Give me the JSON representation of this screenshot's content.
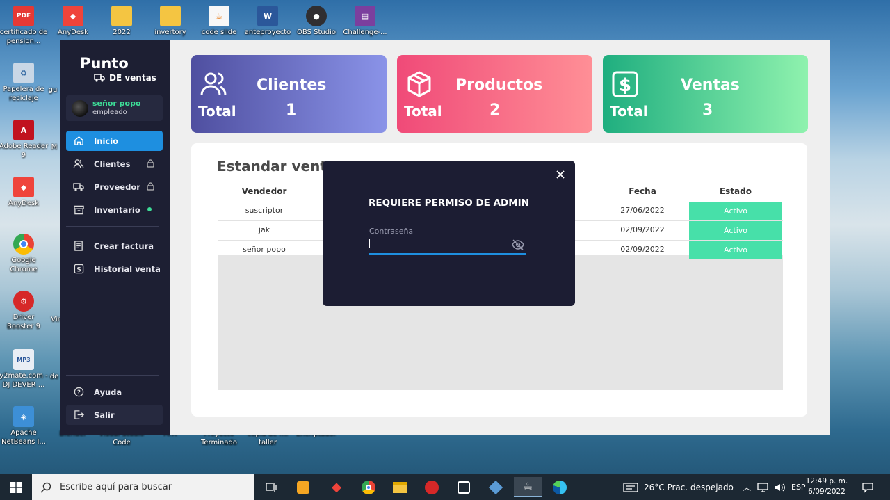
{
  "desktop": {
    "icons": [
      {
        "label": "certificado de pension...",
        "icon": "pdf-icon",
        "color": "#e53935"
      },
      {
        "label": "AnyDesk",
        "icon": "anydesk-icon",
        "color": "#ef443b"
      },
      {
        "label": "2022",
        "icon": "folder-icon",
        "color": "#f4c542"
      },
      {
        "label": "invertory",
        "icon": "folder-icon",
        "color": "#f4c542"
      },
      {
        "label": "code slide",
        "icon": "java-icon",
        "color": "#f7f7f7"
      },
      {
        "label": "anteproyecto",
        "icon": "word-icon",
        "color": "#2b579a"
      },
      {
        "label": "OBS Studio",
        "icon": "obs-icon",
        "color": "#302e31"
      },
      {
        "label": "Challenge-...",
        "icon": "winrar-icon",
        "color": "#7b3f9e"
      },
      {
        "label": "Papelera de reciclaje",
        "icon": "recycle-bin-icon",
        "color": "#c9d7e6"
      },
      {
        "label": "Adobe Reader 9",
        "icon": "adobe-reader-icon",
        "color": "#c1121f"
      },
      {
        "label": "AnyDesk",
        "icon": "anydesk-icon",
        "color": "#ef443b"
      },
      {
        "label": "Google Chrome",
        "icon": "chrome-icon",
        "color": "#4285f4"
      },
      {
        "label": "Driver Booster 9",
        "icon": "driver-booster-icon",
        "color": "#d62828"
      },
      {
        "label": "y2mate.com - DJ DEVER ...",
        "icon": "mp3-icon",
        "color": "#e9eef5"
      },
      {
        "label": "Apache NetBeans I...",
        "icon": "netbeans-icon",
        "color": "#3d8fd6"
      }
    ],
    "partial_labels": [
      "gu",
      "M",
      "Vir",
      "de",
      "Blender",
      "Visual Studio Code",
      "AFA",
      "Proyecto Terminado",
      "copia de mi taller",
      "Encriptador"
    ]
  },
  "app": {
    "brand_title": "Punto",
    "brand_subtitle": "DE ventas",
    "user": {
      "name": "señor popo",
      "role": "empleado"
    },
    "nav": [
      {
        "label": "Inicio",
        "icon": "home-icon",
        "active": true
      },
      {
        "label": "Clientes",
        "icon": "users-icon",
        "lock": true
      },
      {
        "label": "Proveedor",
        "icon": "truck-icon",
        "lock": true
      },
      {
        "label": "Inventario",
        "icon": "archive-icon",
        "dot": true
      },
      {
        "label": "Crear factura",
        "icon": "invoice-icon"
      },
      {
        "label": "Historial venta",
        "icon": "dollar-icon"
      }
    ],
    "footer_nav": [
      {
        "label": "Ayuda",
        "icon": "help-icon"
      },
      {
        "label": "Salir",
        "icon": "logout-icon"
      }
    ],
    "cards": [
      {
        "title": "Clientes",
        "total_label": "Total",
        "value": "1",
        "icon": "users-icon",
        "from": "#4f4fa0",
        "to": "#8a93e8"
      },
      {
        "title": "Productos",
        "total_label": "Total",
        "value": "2",
        "icon": "box-icon",
        "from": "#f04a78",
        "to": "#ff8f96"
      },
      {
        "title": "Ventas",
        "total_label": "Total",
        "value": "3",
        "icon": "dollar-icon",
        "from": "#1fae7f",
        "to": "#8ff2ae"
      }
    ],
    "panel": {
      "title": "Estandar ventas",
      "columns": [
        "Vendedor",
        "Fecha",
        "Estado"
      ],
      "rows": [
        {
          "vendedor": "suscriptor",
          "fecha": "27/06/2022",
          "estado": "Activo"
        },
        {
          "vendedor": "jak",
          "fecha": "02/09/2022",
          "estado": "Activo"
        },
        {
          "vendedor": "señor popo",
          "fecha": "02/09/2022",
          "estado": "Activo"
        }
      ]
    },
    "modal": {
      "title": "REQUIERE PERMISO DE ADMIN",
      "password_label": "Contraseña",
      "password_value": ""
    }
  },
  "taskbar": {
    "search_placeholder": "Escribe aquí para buscar",
    "weather": "26°C  Prac. despejado",
    "language": "ESP",
    "time": "12:49 p. m.",
    "date": "6/09/2022"
  }
}
